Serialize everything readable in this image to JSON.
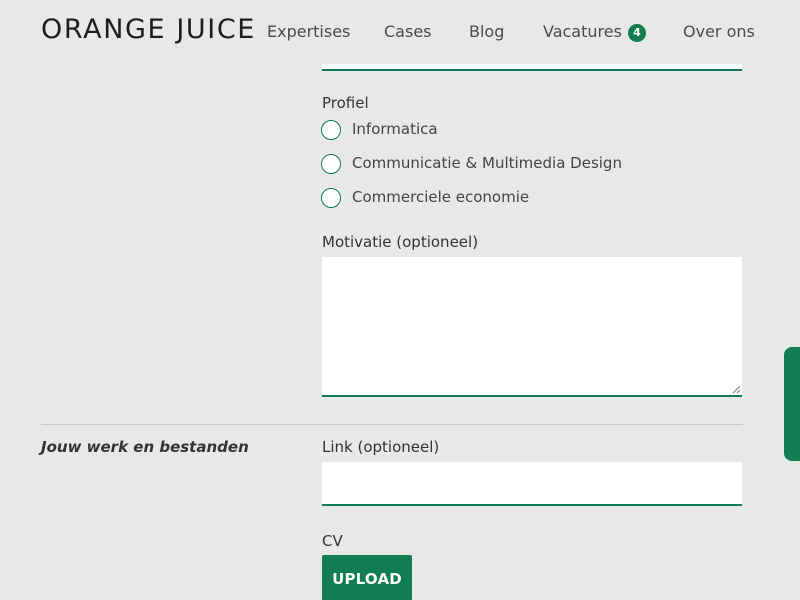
{
  "header": {
    "logo": "ORANGE JUICE",
    "nav": [
      {
        "label": "Expertises"
      },
      {
        "label": "Cases"
      },
      {
        "label": "Blog"
      },
      {
        "label": "Vacatures",
        "badge": "4"
      },
      {
        "label": "Over ons"
      }
    ]
  },
  "form": {
    "profile": {
      "label": "Profiel",
      "options": [
        {
          "label": "Informatica"
        },
        {
          "label": "Communicatie & Multimedia Design"
        },
        {
          "label": "Commerciele economie"
        }
      ]
    },
    "motivation": {
      "label": "Motivatie (optioneel)",
      "value": ""
    },
    "work_section": {
      "title": "Jouw werk en bestanden",
      "link": {
        "label": "Link (optioneel)",
        "value": ""
      },
      "cv": {
        "label": "CV",
        "button": "UPLOAD"
      }
    }
  },
  "colors": {
    "accent": "#127d52",
    "background": "#e8e8e8"
  }
}
